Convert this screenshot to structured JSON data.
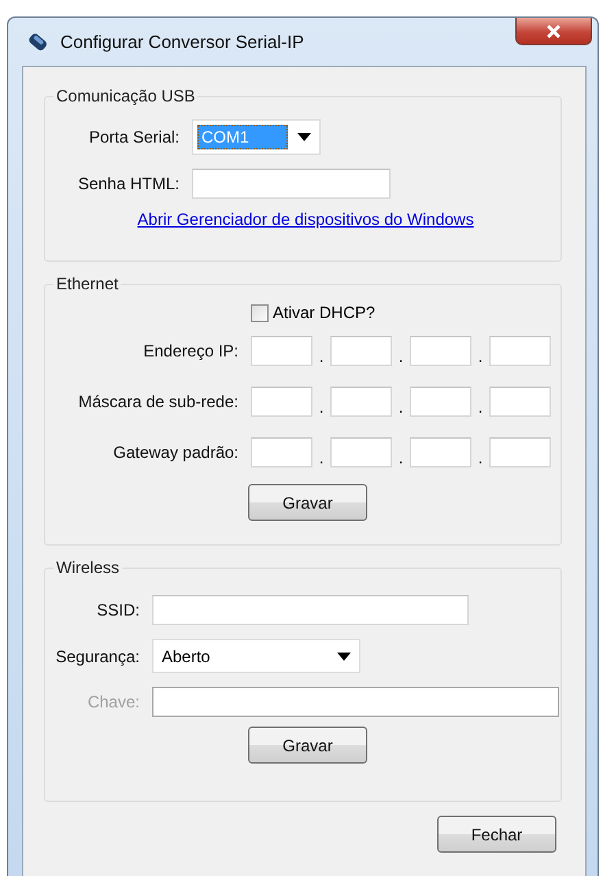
{
  "window": {
    "title": "Configurar Conversor Serial-IP"
  },
  "usb": {
    "title": "Comunicação USB",
    "serial_port": {
      "label": "Porta Serial:",
      "value": "COM1",
      "highlighted": true
    },
    "password": {
      "label": "Senha HTML:"
    },
    "link": "Abrir Gerenciador de dispositivos do Windows"
  },
  "ethernet": {
    "title": "Ethernet",
    "dhcp": {
      "label": "Ativar DHCP?",
      "checked": false
    },
    "address_rows": [
      {
        "label": "Endereço IP:",
        "separators": [
          ".",
          ".",
          "."
        ]
      },
      {
        "label": "Máscara de sub-rede:",
        "separators": [
          ".",
          ".",
          "."
        ]
      },
      {
        "label": "Gateway padrão:",
        "separators": [
          ".",
          ".",
          "."
        ]
      }
    ],
    "button": "Gravar"
  },
  "wireless": {
    "title": "Wireless",
    "ssid": {
      "label": "SSID:"
    },
    "security": {
      "label": "Segurança:",
      "value": "Aberto"
    },
    "key": {
      "label": "Chave:",
      "disabled": true
    },
    "button": "Gravar"
  },
  "buttons": [
    "Fechar"
  ]
}
